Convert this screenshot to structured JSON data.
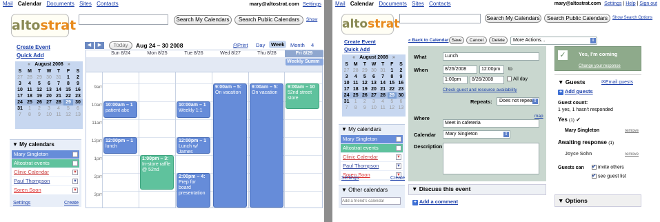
{
  "nav": {
    "mail": "Mail",
    "calendar": "Calendar",
    "documents": "Documents",
    "sites": "Sites",
    "contacts": "Contacts"
  },
  "account": {
    "email": "mary@altostrat.com",
    "settings": "Settings",
    "help": "Help",
    "signout": "Sign out"
  },
  "logo": {
    "part1": "alto",
    "part2": "strat"
  },
  "search": {
    "my": "Search My Calendars",
    "public": "Search Public Calendars",
    "options": "Show Search Options",
    "options_short": "Show"
  },
  "sidebar": {
    "create_event": "Create Event",
    "quick_add": "Quick Add"
  },
  "mini_cal": {
    "month": "August 2008",
    "prev": "«",
    "next": "»",
    "dows": [
      "S",
      "M",
      "T",
      "W",
      "T",
      "F",
      "S"
    ],
    "weeks": [
      [
        "27",
        "28",
        "29",
        "30",
        "31",
        "1",
        "2"
      ],
      [
        "3",
        "4",
        "5",
        "6",
        "7",
        "8",
        "9"
      ],
      [
        "10",
        "11",
        "12",
        "13",
        "14",
        "15",
        "16"
      ],
      [
        "17",
        "18",
        "19",
        "20",
        "21",
        "22",
        "23"
      ],
      [
        "24",
        "25",
        "26",
        "27",
        "28",
        "29",
        "30"
      ],
      [
        "31",
        "1",
        "2",
        "3",
        "4",
        "5",
        "6"
      ],
      [
        "7",
        "8",
        "9",
        "10",
        "11",
        "12",
        "13"
      ]
    ]
  },
  "my_cals": {
    "header": "My calendars",
    "items": [
      {
        "label": "Mary Singleton",
        "color": "#668cd9",
        "text": "#fff"
      },
      {
        "label": "Altostrat events",
        "color": "#5fc29d",
        "text": "#fff"
      },
      {
        "label": "Clinic Calendar",
        "color": "#fff",
        "text": "#c44"
      },
      {
        "label": "Paul Thompson",
        "color": "#fff",
        "text": "#3a4fa3"
      },
      {
        "label": "Soren Soon",
        "color": "#fff",
        "text": "#d33"
      }
    ],
    "settings": "Settings",
    "create": "Create"
  },
  "other_cals": {
    "header": "Other calendars",
    "placeholder": "Add a friend's calendar"
  },
  "toolbar": {
    "today": "Today",
    "range": "Aug 24 – 30 2008",
    "print": "Print",
    "day": "Day",
    "week": "Week",
    "month": "Month",
    "four": "4"
  },
  "week": {
    "days": [
      "Sun 8/24",
      "Mon 8/25",
      "Tue 8/26",
      "Wed 8/27",
      "Thu 8/28",
      "Fri 8/29"
    ],
    "allday": "Weekly Summ",
    "hours": [
      "9am",
      "10am",
      "11am",
      "12pm",
      "1pm",
      "2pm",
      "3pm"
    ],
    "events": [
      {
        "time": "10:00am – 1",
        "title": "patient abc"
      },
      {
        "time": "10:00am – 1",
        "title": "Weekly 1:1"
      },
      {
        "time": "9:00am – 5:",
        "title": "On vacation"
      },
      {
        "time": "9:00am – 5:",
        "title": "On vacation"
      },
      {
        "time": "9:00am – 10",
        "title": "52nd street store"
      },
      {
        "time": "12:00pm – 1",
        "title": "lunch"
      },
      {
        "time": "12:00pm – 1",
        "title": "Lunch w/ James"
      },
      {
        "time": "1:00pm – 3:",
        "title": "In-store raffle @ 52nd"
      },
      {
        "time": "2:00pm – 4:",
        "title": "Prep for board presentation"
      }
    ]
  },
  "details": {
    "back": "« Back to Calendar",
    "save": "Save",
    "cancel": "Cancel",
    "delete": "Delete",
    "more": "More Actions...",
    "what_lbl": "What",
    "what": "Lunch",
    "when_lbl": "When",
    "d1": "8/26/2008",
    "t1": "12:00pm",
    "to": "to",
    "t2": "1:00pm",
    "d2": "8/26/2008",
    "allday": "All day",
    "check": "Check guest and resource availability",
    "repeats_lbl": "Repeats:",
    "repeats": "Does not repeat",
    "where_lbl": "Where",
    "where": "Meet in cafeteria",
    "map": "map",
    "cal_lbl": "Calendar",
    "cal": "Mary Singleton",
    "desc_lbl": "Description",
    "discuss": "Discuss this event",
    "add_comment": "Add a comment"
  },
  "rsvp": {
    "yes": "Yes, I'm coming",
    "change": "Change your response"
  },
  "guests": {
    "header": "Guests",
    "email": "Email guests",
    "add": "Add guests",
    "count_lbl": "Guest count:",
    "count": "1 yes, 1 hasn't responded",
    "yes_lbl": "Yes",
    "yes_n": "(1)",
    "g1": "Mary Singleton",
    "remove": "remove",
    "await_lbl": "Awaiting response",
    "await_n": "(1)",
    "g2": "Joyce Sohn",
    "can_lbl": "Guests can",
    "invite": "invite others",
    "see": "see guest list"
  },
  "options": {
    "header": "Options"
  }
}
